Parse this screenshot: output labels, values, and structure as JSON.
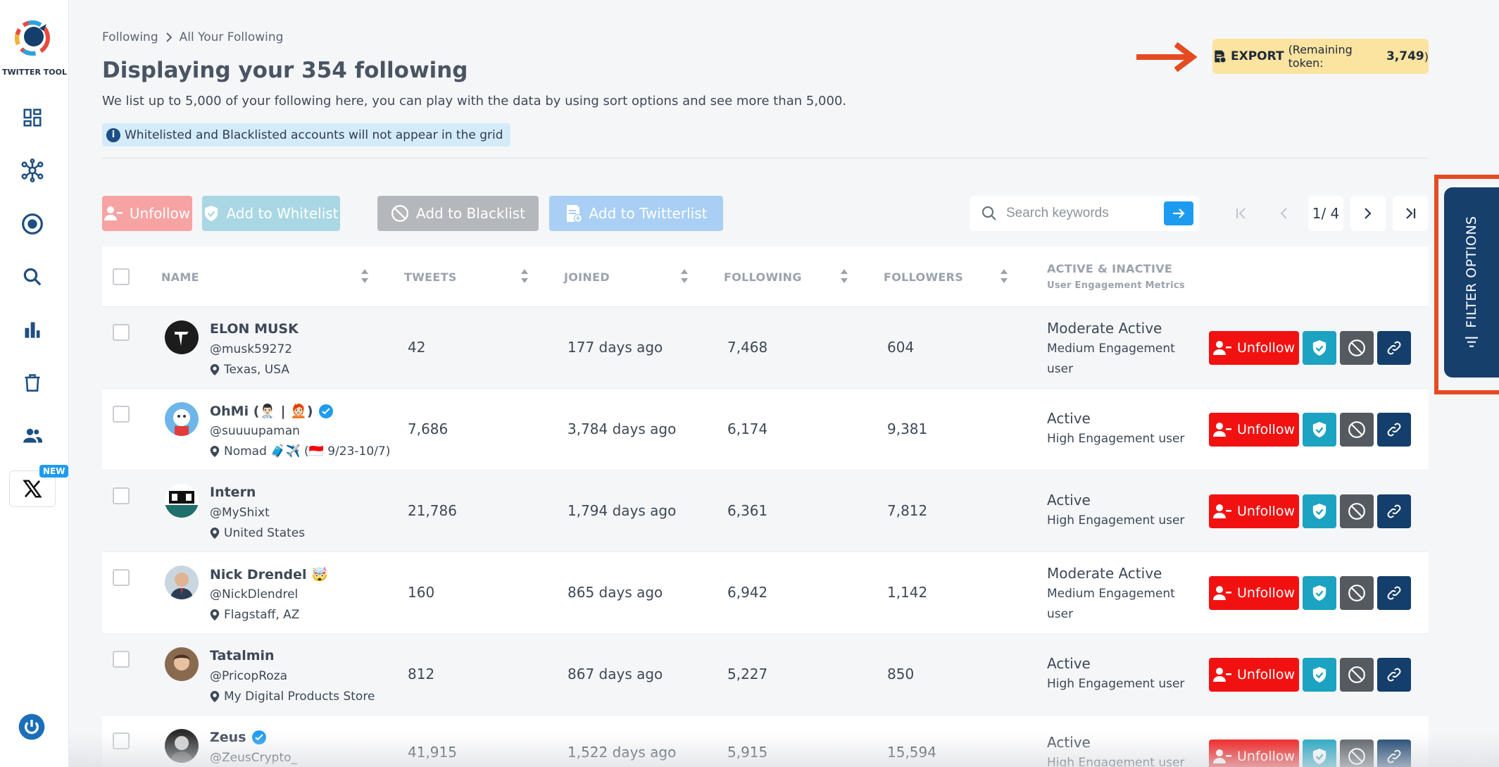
{
  "app": {
    "logo_text": "TWITTER TOOL",
    "new_badge": "NEW"
  },
  "breadcrumb": {
    "parent": "Following",
    "current": "All Your Following"
  },
  "header": {
    "title": "Displaying your 354 following",
    "subtitle": "We list up to 5,000 of your following here, you can play with the data by using sort options and see more than 5,000.",
    "info_icon": "i",
    "info": "Whitelisted and Blacklisted accounts will not appear in the grid"
  },
  "export": {
    "label": "EXPORT",
    "token_prefix": "(Remaining token: ",
    "token_value": "3,749",
    "token_suffix": ")"
  },
  "actions": {
    "unfollow": "Unfollow",
    "whitelist": "Add to Whitelist",
    "blacklist": "Add to Blacklist",
    "twitterlist": "Add to Twitterlist"
  },
  "search": {
    "placeholder": "Search keywords"
  },
  "pagination": {
    "current": "1/ 4"
  },
  "columns": {
    "name": "NAME",
    "tweets": "TWEETS",
    "joined": "JOINED",
    "following": "FOLLOWING",
    "followers": "FOLLOWERS",
    "activity": "ACTIVE & INACTIVE",
    "activity_sub": "User Engagement Metrics"
  },
  "row_unfollow_label": "Unfollow",
  "filter": {
    "label": "FILTER OPTIONS"
  },
  "rows": [
    {
      "name": "ELON MUSK",
      "handle": "@musk59272",
      "location": "Texas, USA",
      "tweets": "42",
      "joined": "177 days ago",
      "following": "7,468",
      "followers": "604",
      "activity": "Moderate Active",
      "engagement": "Medium Engagement user"
    },
    {
      "name": "OhMi (👨🏻‍⚕️ | 🧑🏻‍🦰)",
      "handle": "@suuuupaman",
      "location": "Nomad 🧳✈️ (🇮🇩 9/23-10/7)",
      "tweets": "7,686",
      "joined": "3,784 days ago",
      "following": "6,174",
      "followers": "9,381",
      "activity": "Active",
      "engagement": "High Engagement user"
    },
    {
      "name": "Intern",
      "handle": "@MyShixt",
      "location": "United States",
      "tweets": "21,786",
      "joined": "1,794 days ago",
      "following": "6,361",
      "followers": "7,812",
      "activity": "Active",
      "engagement": "High Engagement user"
    },
    {
      "name": "Nick Drendel 🤯",
      "handle": "@NickDlendrel",
      "location": "Flagstaff, AZ",
      "tweets": "160",
      "joined": "865 days ago",
      "following": "6,942",
      "followers": "1,142",
      "activity": "Moderate Active",
      "engagement": "Medium Engagement user"
    },
    {
      "name": "Tatalmin",
      "handle": "@PricopRoza",
      "location": "My Digital Products Store",
      "tweets": "812",
      "joined": "867 days ago",
      "following": "5,227",
      "followers": "850",
      "activity": "Active",
      "engagement": "High Engagement user"
    },
    {
      "name": "Zeus",
      "handle": "@ZeusCrypto_",
      "location": "",
      "tweets": "41,915",
      "joined": "1,522 days ago",
      "following": "5,915",
      "followers": "15,594",
      "activity": "Active",
      "engagement": "High Engagement user"
    }
  ],
  "colors": {
    "accent": "#1d9bf0",
    "danger": "#f21111",
    "navy": "#163f6c",
    "teal": "#1ba3c1",
    "arrow": "#e54b21"
  }
}
